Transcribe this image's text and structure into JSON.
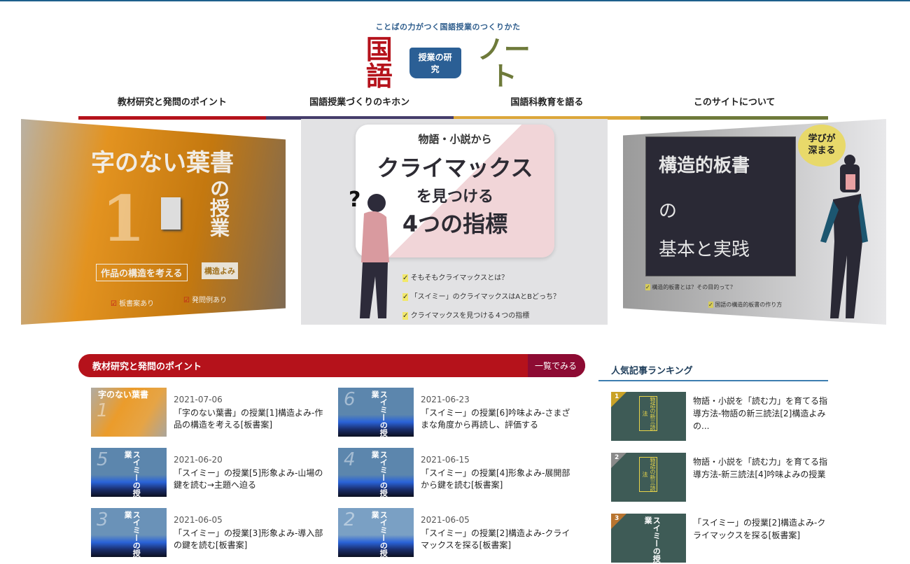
{
  "header": {
    "tagline": "ことばの力がつく国語授業のつくりかた",
    "logo": {
      "part1": "国語",
      "book": "授業の研究",
      "part2": "ノート"
    }
  },
  "nav": [
    {
      "label": "教材研究と発問のポイント",
      "color": "#b5121b"
    },
    {
      "label": "国語授業づくりのキホン",
      "color": "#453d6b"
    },
    {
      "label": "国語科教育を語る",
      "color": "#dca73a"
    },
    {
      "label": "このサイトについて",
      "color": "#6e7a3a"
    }
  ],
  "slides": [
    {
      "title": "字のない葉書",
      "num": "1",
      "sub": "の授業",
      "box": "作品の構造を考える",
      "tag": "構造よみ",
      "checks": [
        "板書案あり",
        "発問例あり"
      ]
    },
    {
      "kicker": "物語・小説から",
      "title": "クライマックス",
      "line2": "を見つける",
      "line3": "4つの指標",
      "checks": [
        "そもそもクライマックスとは？",
        "「スイミー」のクライマックスはAとBどっち？",
        "クライマックスを見つける４つの指標"
      ]
    },
    {
      "bubble": "学びが深まる",
      "title": "構造的板書",
      "line2": "の",
      "line3": "基本と実践",
      "checks": [
        "構造的板書とは？その目的って？",
        "国語の構造的板書の作り方"
      ]
    }
  ],
  "section": {
    "title": "教材研究と発問のポイント",
    "more": "一覧でみる",
    "articles": [
      {
        "date": "2021-07-06",
        "title": "「字のない葉書」の授業[1]構造よみ-作品の構造を考える[板書案]",
        "thumb": "字のない葉書",
        "num": "1"
      },
      {
        "date": "2021-06-23",
        "title": "「スイミー」の授業[6]吟味よみ-さまざまな角度から再読し、評価する",
        "thumb": "スイミーの授業",
        "num": "6"
      },
      {
        "date": "2021-06-20",
        "title": "「スイミー」の授業[5]形象よみ-山場の鍵を読む→主題へ迫る",
        "thumb": "スイミーの授業",
        "num": "5"
      },
      {
        "date": "2021-06-15",
        "title": "「スイミー」の授業[4]形象よみ-展開部から鍵を読む[板書案]",
        "thumb": "スイミーの授業",
        "num": "4"
      },
      {
        "date": "2021-06-05",
        "title": "「スイミー」の授業[3]形象よみ-導入部の鍵を読む[板書案]",
        "thumb": "スイミーの授業",
        "num": "3"
      },
      {
        "date": "2021-06-05",
        "title": "「スイミー」の授業[2]構造よみ-クライマックスを探る[板書案]",
        "thumb": "スイミーの授業",
        "num": "2"
      }
    ]
  },
  "ranking": {
    "title": "人気記事ランキング",
    "items": [
      {
        "rank": "1",
        "title": "物語・小説を「読む力」を育てる指導方法-物語の新三読法[2]構造よみの...",
        "thumb": "物語の新三読法",
        "color": "#c9a227"
      },
      {
        "rank": "2",
        "title": "物語・小説を「読む力」を育てる指導方法-新三読法[4]吟味よみの授業",
        "thumb": "物語の新三読法",
        "color": "#8a8a8a"
      },
      {
        "rank": "3",
        "title": "「スイミー」の授業[2]構造よみ-クライマックスを探る[板書案]",
        "thumb": "スイミーの授業",
        "color": "#b8742f"
      }
    ]
  }
}
